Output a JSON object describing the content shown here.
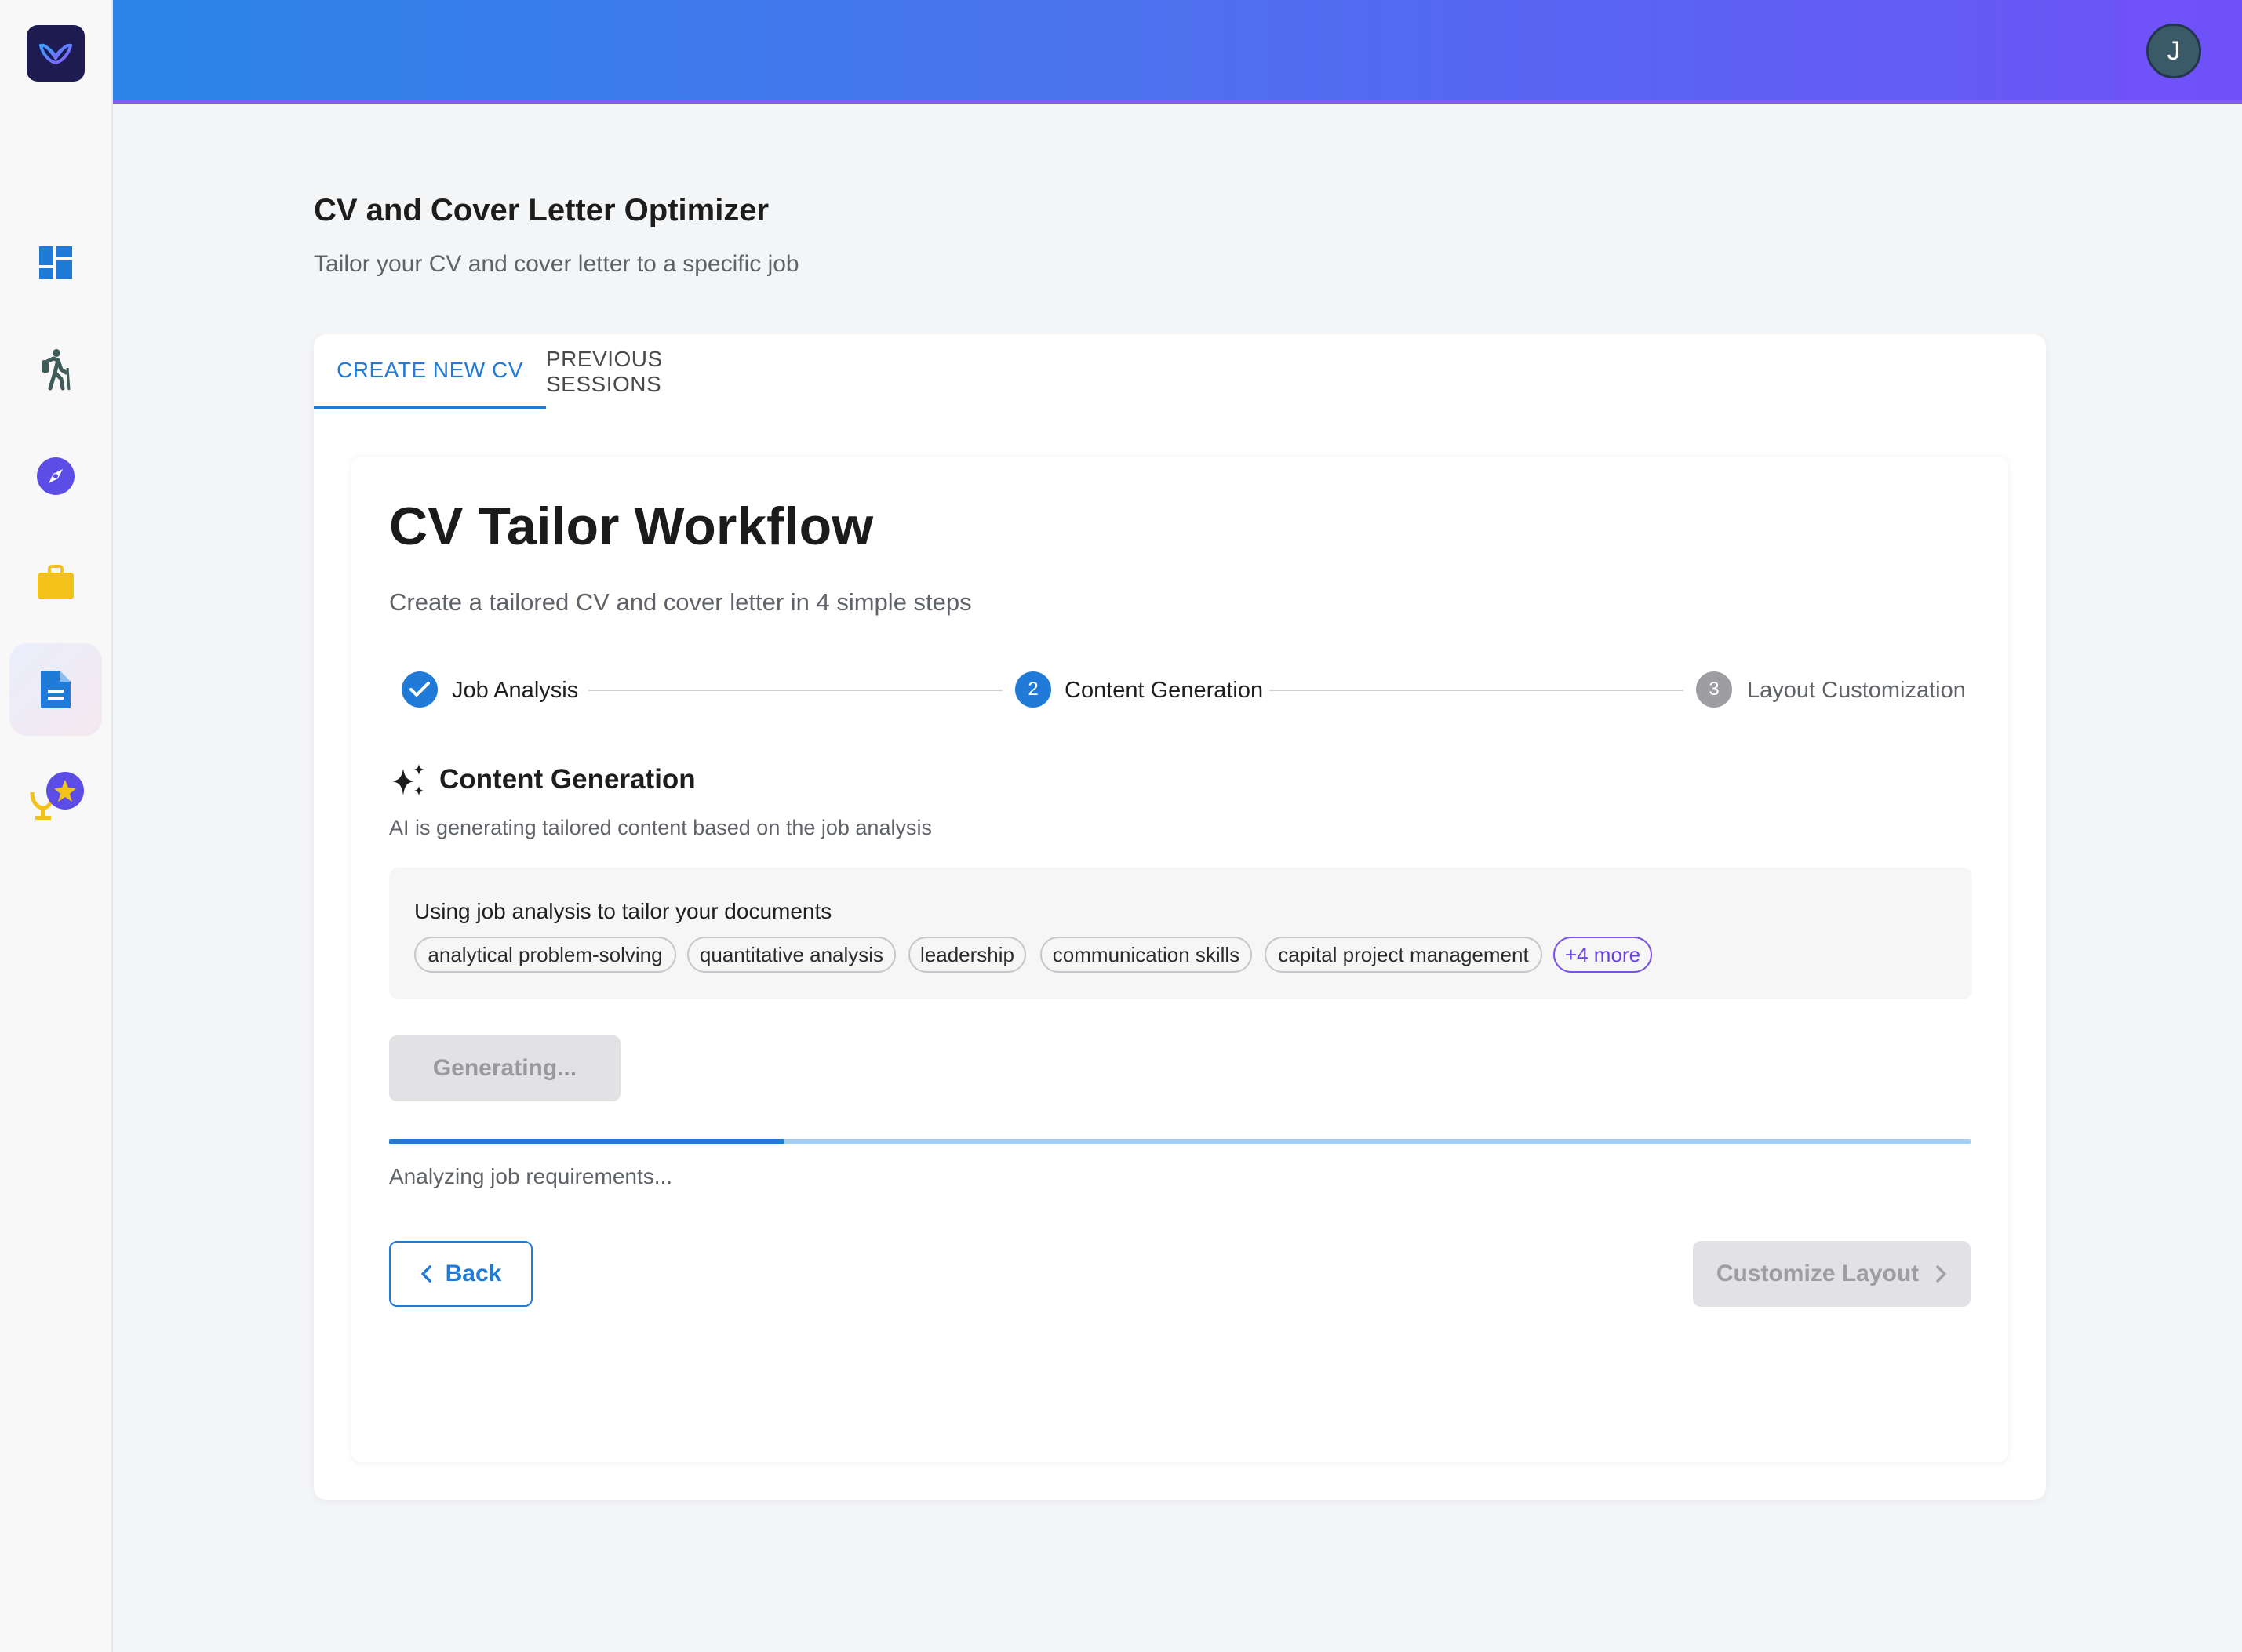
{
  "user": {
    "avatar_initial": "J"
  },
  "sidebar": {
    "items": [
      {
        "name": "dashboard",
        "icon": "dashboard-icon",
        "color": "#1f7ad8"
      },
      {
        "name": "career-path",
        "icon": "hiking-person-icon",
        "color": "#3f5b57"
      },
      {
        "name": "explore",
        "icon": "compass-icon",
        "color": "#5b4de6"
      },
      {
        "name": "jobs",
        "icon": "briefcase-icon",
        "color": "#f2c21b"
      },
      {
        "name": "cv-optimizer",
        "icon": "document-icon",
        "color": "#1f7ad8",
        "active": true
      },
      {
        "name": "achievements",
        "icon": "trophy-star-icon",
        "color": "#f2c21b"
      }
    ]
  },
  "page": {
    "title": "CV and Cover Letter Optimizer",
    "subtitle": "Tailor your CV and cover letter to a specific job"
  },
  "tabs": [
    {
      "label": "CREATE NEW CV",
      "active": true
    },
    {
      "label": "PREVIOUS SESSIONS",
      "active": false
    }
  ],
  "workflow": {
    "title": "CV Tailor Workflow",
    "subtitle": "Create a tailored CV and cover letter in 4 simple steps",
    "steps": [
      {
        "number": "1",
        "label": "Job Analysis",
        "state": "completed"
      },
      {
        "number": "2",
        "label": "Content Generation",
        "state": "active"
      },
      {
        "number": "3",
        "label": "Layout Customization",
        "state": "pending"
      }
    ]
  },
  "content_generation": {
    "title": "Content Generation",
    "subtitle": "AI is generating tailored content based on the job analysis",
    "analysis_heading": "Using job analysis to tailor your documents",
    "skills": [
      "analytical problem-solving",
      "quantitative analysis",
      "leadership",
      "communication skills",
      "capital project management"
    ],
    "more_label": "+4 more",
    "generate_button": "Generating...",
    "progress_fraction": 0.25,
    "progress_text": "Analyzing job requirements..."
  },
  "navigation": {
    "back_label": "Back",
    "next_label": "Customize Layout"
  },
  "colors": {
    "primary": "#1f7ad8",
    "accent": "#6a42df",
    "header_gradient_start": "#2a84e6",
    "header_gradient_end": "#6d52f7"
  }
}
